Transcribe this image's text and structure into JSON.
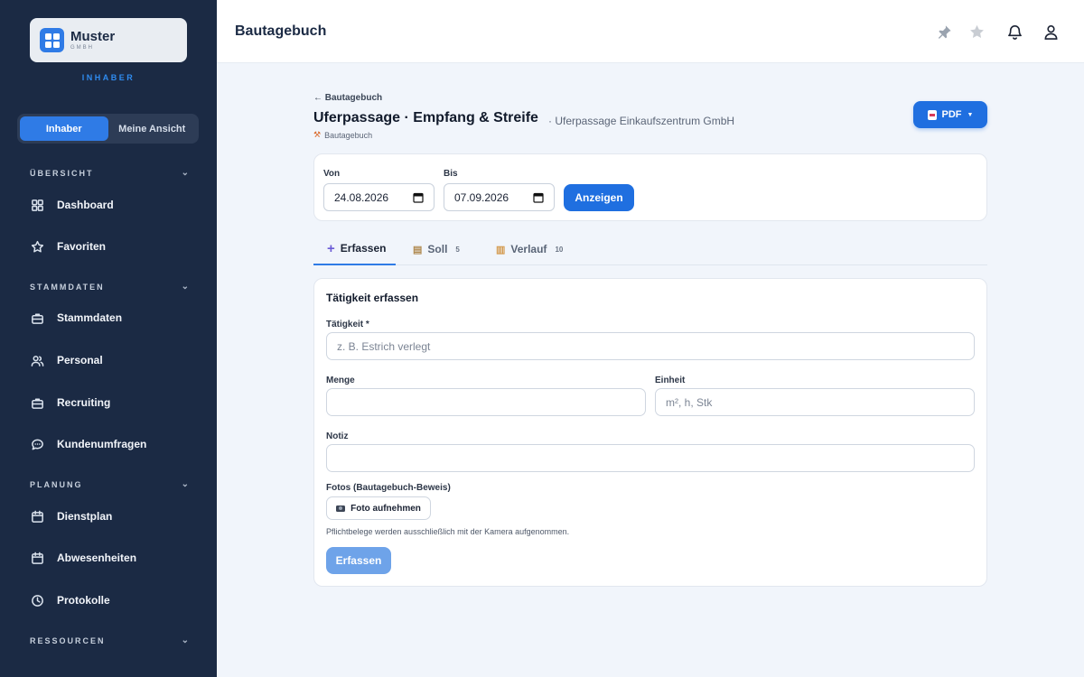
{
  "sidebar": {
    "brand": {
      "name": "Muster",
      "sub": "GMBH"
    },
    "role": "INHABER",
    "view_toggle": {
      "owner": "Inhaber",
      "mine": "Meine Ansicht",
      "active": "owner"
    },
    "sections": {
      "overview": "ÜBERSICHT",
      "master": "STAMMDATEN",
      "planning": "PLANUNG",
      "resources": "RESSOURCEN"
    },
    "items": {
      "dashboard": "Dashboard",
      "favorites": "Favoriten",
      "master_data": "Stammdaten",
      "staff": "Personal",
      "recruiting": "Recruiting",
      "surveys": "Kundenumfragen",
      "schedule": "Dienstplan",
      "absences": "Abwesenheiten",
      "logs": "Protokolle"
    }
  },
  "header": {
    "title": "Bautagebuch",
    "icons": [
      "pin-icon",
      "star-icon",
      "bell-icon",
      "user-icon"
    ]
  },
  "page": {
    "back_link": "← Bautagebuch",
    "title": "Uferpassage · Empfang & Streife",
    "subtitle": "· Uferpassage Einkaufszentrum GmbH",
    "tag": "Bautagebuch",
    "pdf_label": "PDF"
  },
  "date_filter": {
    "from_label": "Von",
    "from_value": "24.08.2026",
    "to_label": "Bis",
    "to_value": "07.09.2026",
    "show_label": "Anzeigen"
  },
  "tabs": [
    {
      "label": "Erfassen",
      "count": "",
      "active": true
    },
    {
      "label": "Soll",
      "count": "5",
      "active": false
    },
    {
      "label": "Verlauf",
      "count": "10",
      "active": false
    }
  ],
  "form": {
    "title": "Tätigkeit erfassen",
    "activity_label": "Tätigkeit *",
    "activity_placeholder": "z. B. Estrich verlegt",
    "quantity_label": "Menge",
    "unit_label": "Einheit",
    "unit_placeholder": "m², h, Stk",
    "note_label": "Notiz",
    "photos_label": "Fotos (Bautagebuch-Beweis)",
    "photo_button": "Foto aufnehmen",
    "hint": "Pflichtbelege werden ausschließlich mit der Kamera aufgenommen.",
    "submit_label": "Erfassen"
  },
  "colors": {
    "sidebar_bg": "#1b2a44",
    "accent": "#1f6fe0",
    "page_bg": "#f1f5fb"
  }
}
